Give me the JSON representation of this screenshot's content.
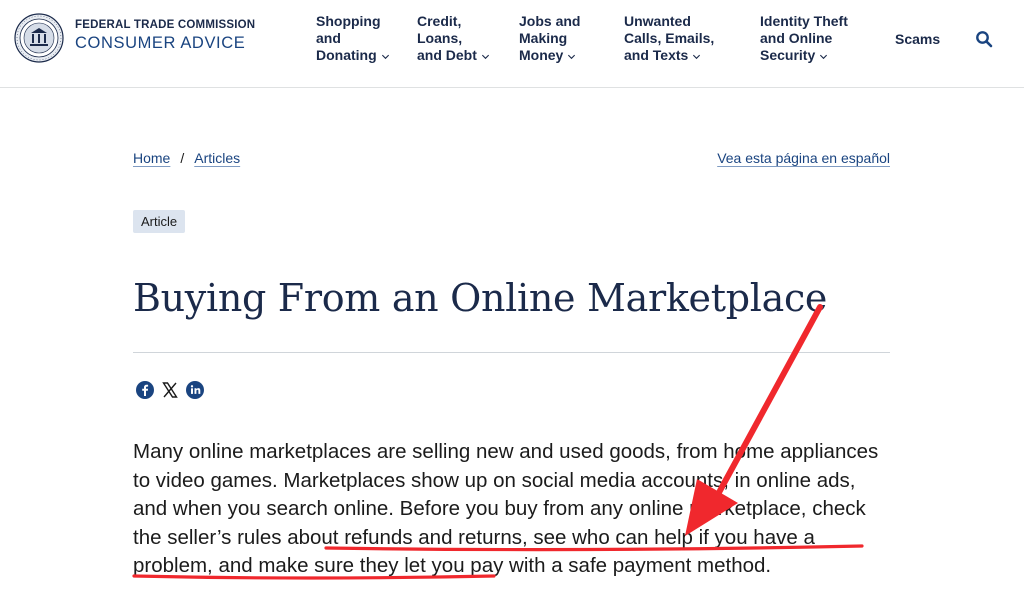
{
  "header": {
    "agency": "FEDERAL TRADE COMMISSION",
    "site_name": "CONSUMER ADVICE",
    "nav": [
      {
        "lines": [
          "Shopping",
          "and",
          "Donating"
        ]
      },
      {
        "lines": [
          "Credit,",
          "Loans,",
          "and Debt"
        ]
      },
      {
        "lines": [
          "Jobs and",
          "Making",
          "Money"
        ]
      },
      {
        "lines": [
          "Unwanted",
          "Calls, Emails,",
          "and Texts"
        ]
      },
      {
        "lines": [
          "Identity Theft",
          "and Online",
          "Security"
        ]
      }
    ],
    "scams": "Scams",
    "icons": {
      "logo": "ftc-seal-logo",
      "search": "search-icon",
      "chevron": "chevron-down-icon"
    }
  },
  "breadcrumb": {
    "home": "Home",
    "sep": "/",
    "articles": "Articles"
  },
  "lang_link": "Vea esta página en español",
  "tag": "Article",
  "title": "Buying From an Online Marketplace",
  "share": {
    "icons": [
      "facebook-icon",
      "x-icon",
      "linkedin-icon"
    ]
  },
  "body": {
    "p1": "Many online marketplaces are selling new and used goods, from home appliances to video games. Marketplaces show up on social media accounts, in online ads, and when you search online. Before you buy from any online marketplace, ",
    "p2": "check the seller’s rules about refunds and returns, see who can help if you have a problem,",
    "p3": " and make sure they let you pay with a safe payment method."
  },
  "colors": {
    "navy": "#1b2a4a",
    "link": "#1a4480",
    "annotation": "#f0282d",
    "tag_bg": "#dce4ef"
  }
}
